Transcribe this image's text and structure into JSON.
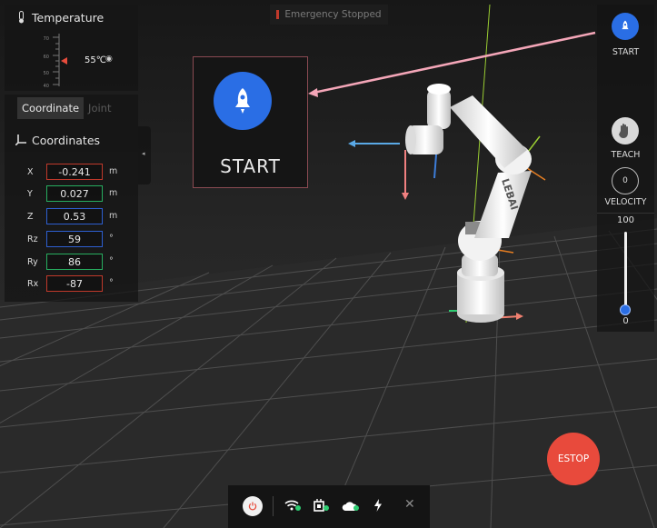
{
  "temperature": {
    "title": "Temperature",
    "value": "55℃",
    "scale_ticks": [
      "70",
      "60",
      "50",
      "40"
    ],
    "unit_icon": "◉"
  },
  "coord_panel": {
    "tabs": [
      {
        "label": "Coordinate",
        "active": true
      },
      {
        "label": "Joint",
        "active": false
      }
    ],
    "title": "Coordinates",
    "rows": [
      {
        "label": "X",
        "value": "-0.241",
        "unit": "m",
        "color": "#c0392b"
      },
      {
        "label": "Y",
        "value": "0.027",
        "unit": "m",
        "color": "#27ae60"
      },
      {
        "label": "Z",
        "value": "0.53",
        "unit": "m",
        "color": "#2e5fd1"
      },
      {
        "label": "Rz",
        "value": "59",
        "unit": "°",
        "color": "#2e5fd1"
      },
      {
        "label": "Ry",
        "value": "86",
        "unit": "°",
        "color": "#27ae60"
      },
      {
        "label": "Rx",
        "value": "-87",
        "unit": "°",
        "color": "#c0392b"
      }
    ],
    "collapse_icon": "◂"
  },
  "status_banner": {
    "text": "Emergency Stopped",
    "indicator_color": "#c0392b"
  },
  "start_box": {
    "label": "START",
    "icon": "rocket-icon",
    "accent": "#2a6ee5"
  },
  "right_panel": {
    "start_label": "START",
    "teach_label": "TEACH",
    "velocity_value": "0",
    "velocity_label": "VELOCITY",
    "slider_max": "100",
    "slider_min": "0",
    "slider_value": 0
  },
  "estop": {
    "label": "ESTOP",
    "color": "#e84a3c"
  },
  "status_bar": {
    "icons": [
      "power-icon",
      "wifi-icon",
      "controller-icon",
      "cloud-icon",
      "lightning-icon",
      "close-icon"
    ],
    "status_color": "#2ecc71",
    "close_symbol": "✕"
  },
  "robot": {
    "brand": "LEBAI"
  }
}
